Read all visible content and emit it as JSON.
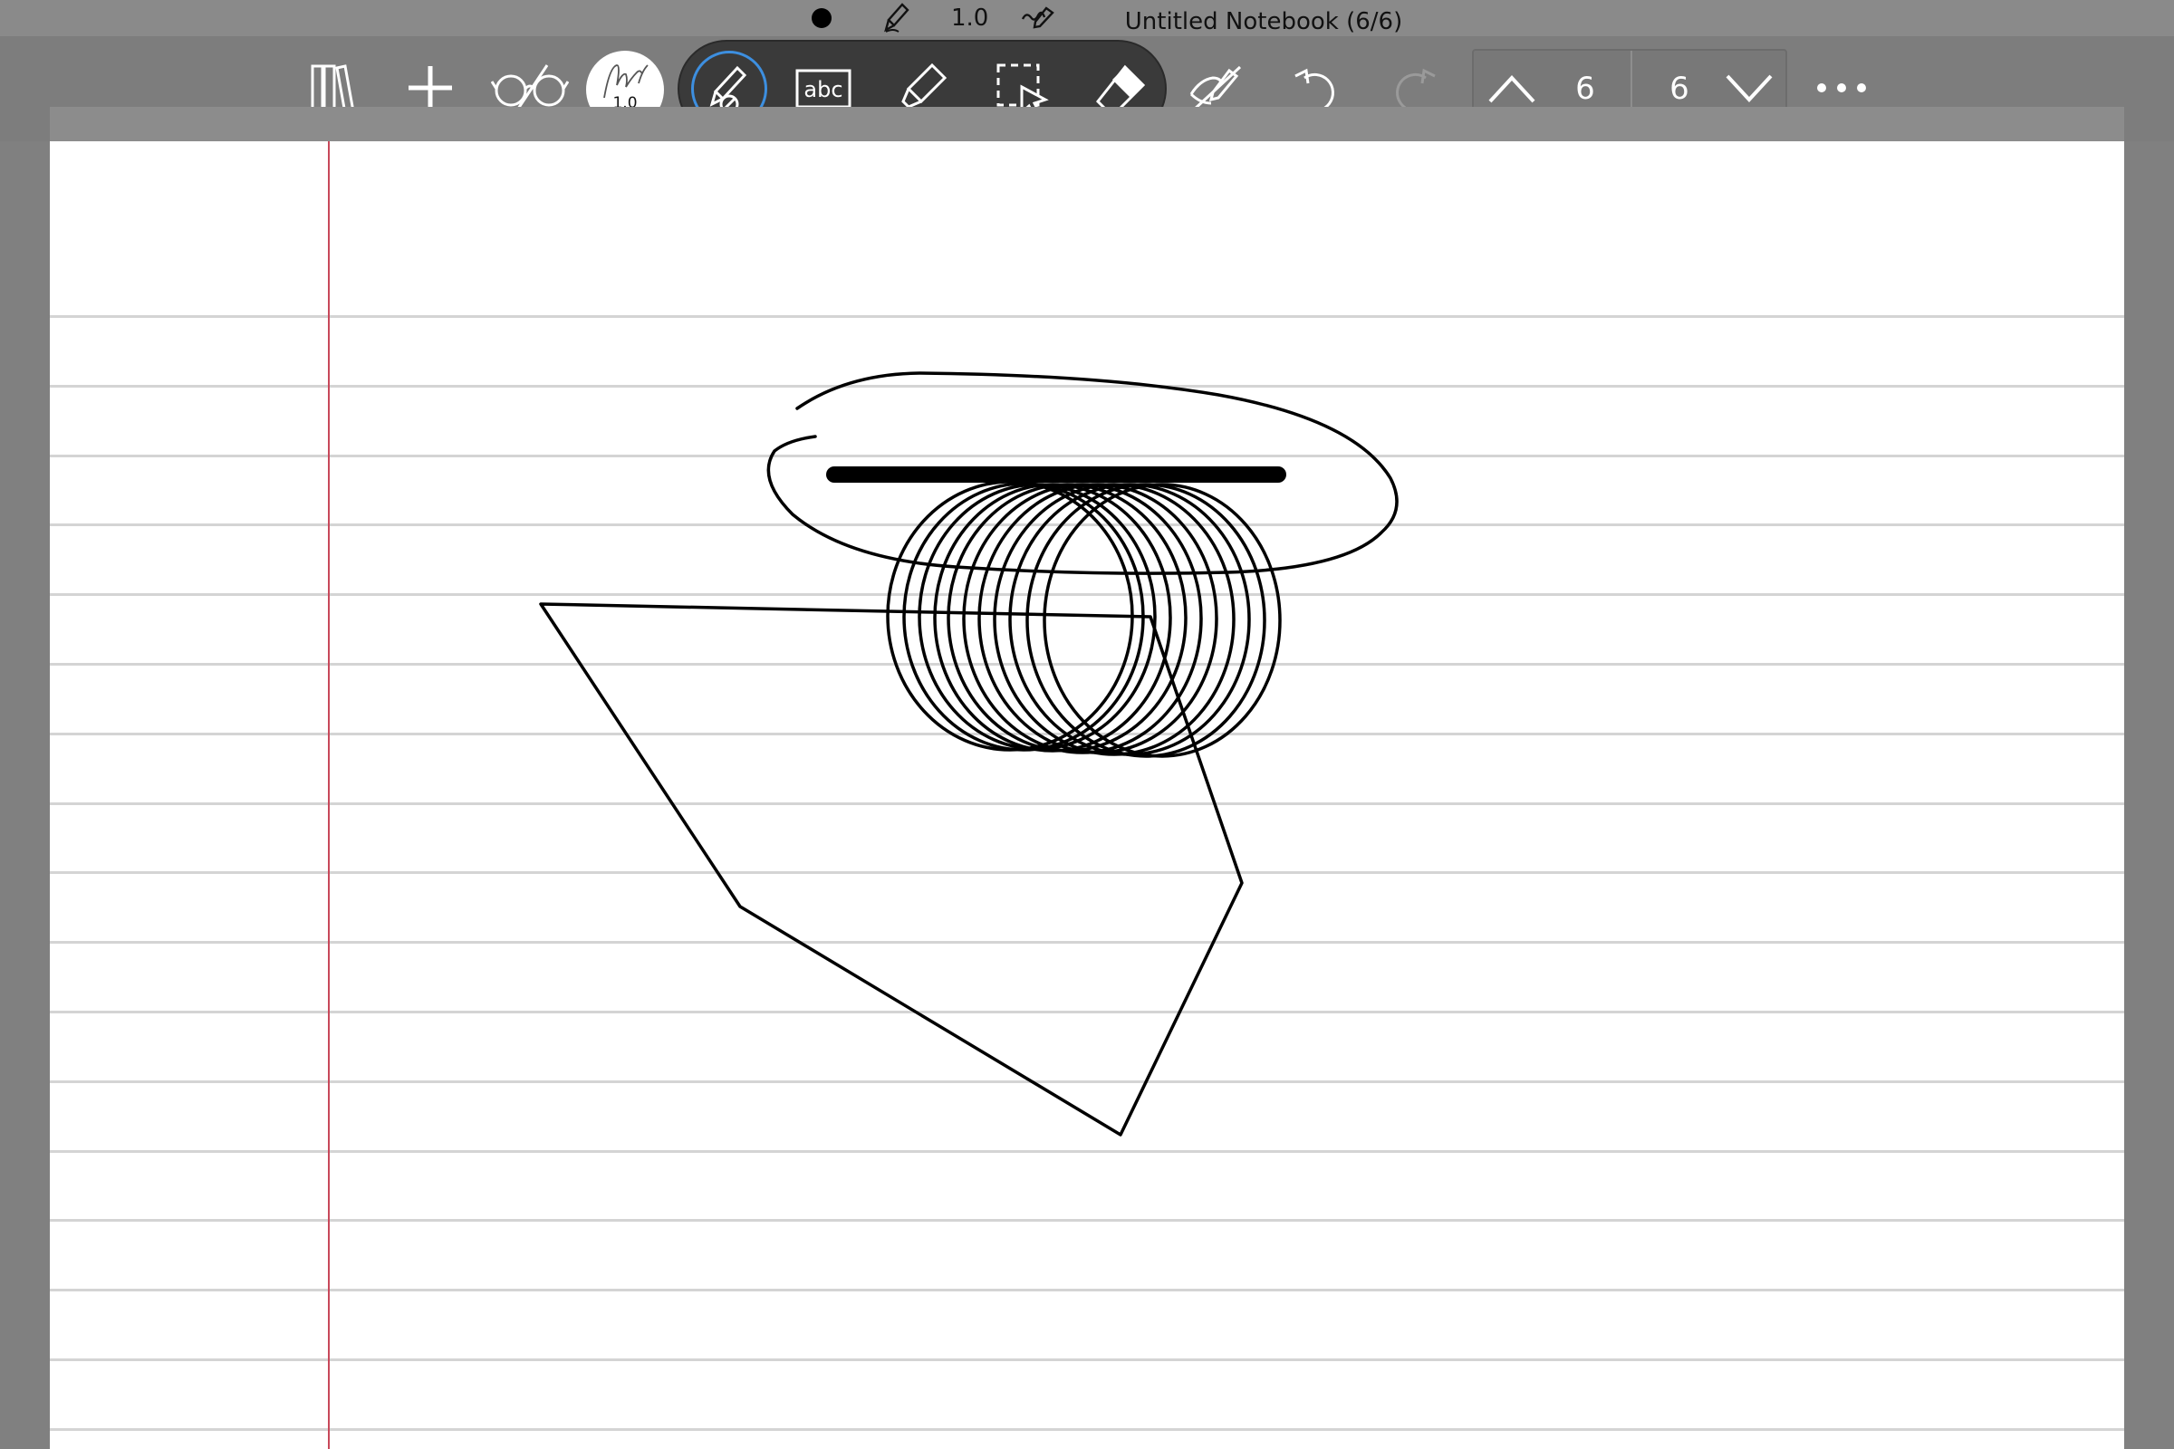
{
  "status_bar": {
    "pen_color_icon": "filled-circle-icon",
    "pen_type_icon": "fountain-pen-icon",
    "pen_size": "1.0",
    "handwriting_icon": "handwriting-icon",
    "title": "Untitled Notebook (6/6)"
  },
  "toolbar": {
    "library_icon": "library-icon",
    "add_icon": "plus-icon",
    "read_mode_icon": "glasses-icon",
    "pen_size_label": "1.0",
    "tools": [
      {
        "name": "pen",
        "icon": "pen-icon",
        "active": true
      },
      {
        "name": "text",
        "icon": "text-box-icon",
        "label": "abc"
      },
      {
        "name": "highlighter",
        "icon": "highlighter-icon"
      },
      {
        "name": "lasso",
        "icon": "lasso-select-icon"
      },
      {
        "name": "eraser",
        "icon": "eraser-icon"
      }
    ],
    "hide_ink_icon": "hide-ink-icon",
    "undo_icon": "undo-icon",
    "redo_icon": "redo-icon",
    "page_nav": {
      "prev_icon": "chevron-up-icon",
      "current_page": "6",
      "total_pages": "6",
      "next_icon": "chevron-down-icon"
    },
    "more_icon": "more-icon"
  },
  "colors": {
    "background": "#808080",
    "toolbar": "#7d7d7d",
    "tool_group": "#3a3a3a",
    "active_ring": "#3d8fe0",
    "paper": "#ffffff",
    "rule": "#d4d4d4",
    "margin": "#c8485a",
    "ink": "#000000"
  }
}
